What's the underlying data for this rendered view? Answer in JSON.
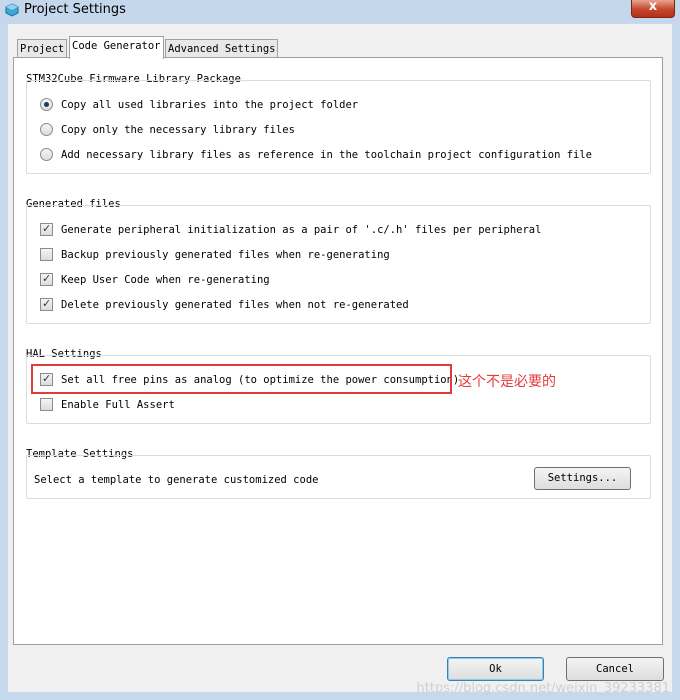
{
  "window": {
    "title": "Project Settings",
    "close_label": "x"
  },
  "tabs": [
    "Project",
    "Code Generator",
    "Advanced Settings"
  ],
  "active_tab": "Code Generator",
  "firmware_group": {
    "title": "STM32Cube Firmware Library Package",
    "options": [
      {
        "label": "Copy all used libraries into the project folder",
        "selected": true
      },
      {
        "label": "Copy only the necessary library files",
        "selected": false
      },
      {
        "label": "Add necessary library files as reference in the toolchain project configuration file",
        "selected": false
      }
    ]
  },
  "generated_files_group": {
    "title": "Generated files",
    "options": [
      {
        "label": "Generate peripheral initialization as a pair of '.c/.h' files per peripheral",
        "checked": true
      },
      {
        "label": "Backup previously generated files when re-generating",
        "checked": false
      },
      {
        "label": "Keep User Code when re-generating",
        "checked": true
      },
      {
        "label": "Delete previously generated files when not re-generated",
        "checked": true
      }
    ]
  },
  "hal_group": {
    "title": "HAL Settings",
    "options": [
      {
        "label": "Set all free pins as analog (to optimize the power consumption)",
        "checked": true
      },
      {
        "label": "Enable Full Assert",
        "checked": false
      }
    ]
  },
  "template_group": {
    "title": "Template Settings",
    "description": "Select a template to generate customized code",
    "settings_button": "Settings..."
  },
  "buttons": {
    "ok": "Ok",
    "cancel": "Cancel"
  },
  "annotation": {
    "text": "这个不是必要的",
    "color": "#e23b3b"
  },
  "watermark": "https://blog.csdn.net/weixin_39233381",
  "icons": {
    "app": "cube-icon",
    "close": "close-icon",
    "check": "✓"
  }
}
